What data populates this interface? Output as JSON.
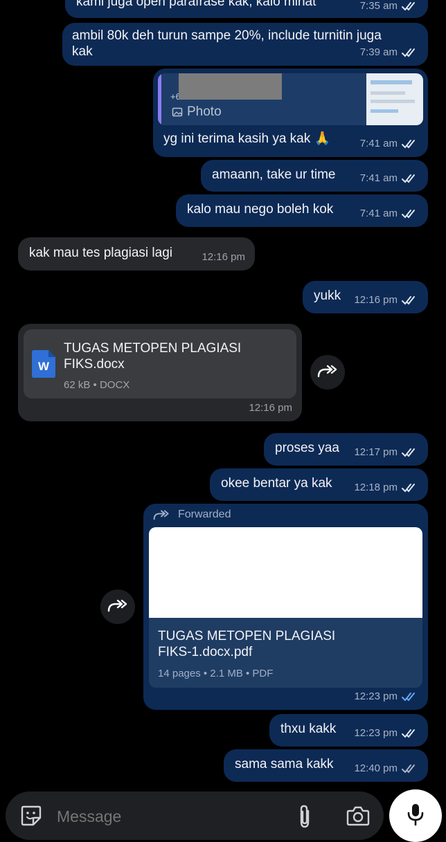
{
  "messages": [
    {
      "id": "m0",
      "text": "kami juga open parafrase kak, kalo minat",
      "time": "7:35 am"
    },
    {
      "id": "m1",
      "line1": "ambil 80k deh turun sampe 20%, include turnitin juga",
      "line2": "kak",
      "time": "7:39 am"
    },
    {
      "id": "m2",
      "reply_sender": "+6",
      "reply_label": "Photo",
      "text": "yg ini terima kasih ya kak 🙏",
      "time": "7:41 am"
    },
    {
      "id": "m3",
      "text": "amaann, take ur time",
      "time": "7:41 am"
    },
    {
      "id": "m4",
      "text": "kalo mau nego boleh kok",
      "time": "7:41 am"
    },
    {
      "id": "m5",
      "text": "kak mau tes plagiasi lagi",
      "time": "12:16 pm"
    },
    {
      "id": "m6",
      "text": "yukk",
      "time": "12:16 pm"
    },
    {
      "id": "m7",
      "file_line1": "TUGAS METOPEN PLAGIASI",
      "file_line2": "FIKS.docx",
      "file_meta": "62 kB • DOCX",
      "doc_letter": "W",
      "time": "12:16 pm"
    },
    {
      "id": "m8",
      "text": "proses yaa",
      "time": "12:17 pm"
    },
    {
      "id": "m9",
      "text": "okee bentar ya kak",
      "time": "12:18 pm"
    },
    {
      "id": "m10",
      "forwarded_label": "Forwarded",
      "file_line1": "TUGAS METOPEN PLAGIASI",
      "file_line2": "FIKS-1.docx.pdf",
      "file_meta": "14 pages • 2.1 MB • PDF",
      "time": "12:23 pm"
    },
    {
      "id": "m11",
      "text": "thxu kakk",
      "time": "12:23 pm"
    },
    {
      "id": "m12",
      "text": "sama sama kakk",
      "time": "12:40 pm"
    }
  ],
  "input": {
    "placeholder": "Message"
  },
  "colors": {
    "outgoing_bubble": "#0d2a55",
    "incoming_bubble": "#26282c",
    "read_tick": "#dfe6f0",
    "seen_tick_blue": "#64a8ef",
    "reply_accent": "#8d7bf2",
    "docx_blue": "#2f6fd6"
  },
  "icons": [
    "double-check-icon",
    "image-icon",
    "docx-file-icon",
    "forward-icon",
    "sticker-icon",
    "paperclip-icon",
    "camera-icon",
    "microphone-icon"
  ]
}
